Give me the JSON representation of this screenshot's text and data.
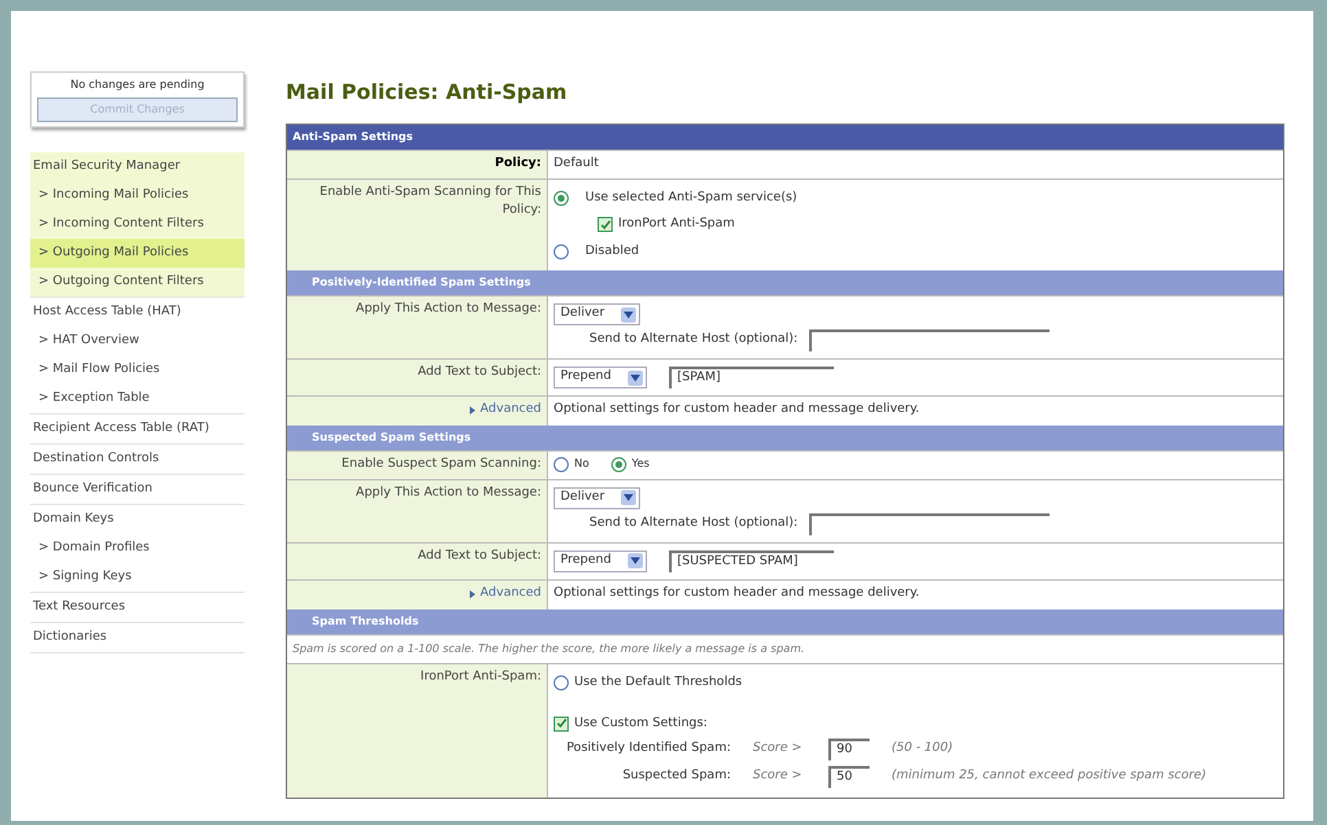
{
  "sidebar": {
    "pending_text": "No changes are pending",
    "commit_button": {
      "label": "Commit Changes",
      "disabled": true
    },
    "groups": [
      {
        "label": "Email Security Manager",
        "highlighted": true,
        "items": [
          {
            "label": "> Incoming Mail Policies",
            "selected": false
          },
          {
            "label": "> Incoming Content Filters",
            "selected": false
          },
          {
            "label": "> Outgoing Mail Policies",
            "selected": true
          },
          {
            "label": "> Outgoing Content Filters",
            "selected": false
          }
        ]
      },
      {
        "label": "Host Access Table (HAT)",
        "highlighted": false,
        "items": [
          {
            "label": "> HAT Overview",
            "selected": false
          },
          {
            "label": "> Mail Flow Policies",
            "selected": false
          },
          {
            "label": "> Exception Table",
            "selected": false
          }
        ]
      },
      {
        "label": "Recipient Access Table (RAT)",
        "highlighted": false
      },
      {
        "label": "Destination Controls",
        "highlighted": false
      },
      {
        "label": "Bounce Verification",
        "highlighted": false
      },
      {
        "label": "Domain Keys",
        "highlighted": false,
        "items": [
          {
            "label": "> Domain Profiles",
            "selected": false
          },
          {
            "label": "> Signing Keys",
            "selected": false
          }
        ]
      },
      {
        "label": "Text Resources",
        "highlighted": false
      },
      {
        "label": "Dictionaries",
        "highlighted": false
      }
    ]
  },
  "page_title": "Mail Policies: Anti-Spam",
  "sections": [
    {
      "title": "Anti-Spam Settings",
      "main": true,
      "rows": [
        {
          "kind": "policy",
          "label": "Policy:",
          "value": "Default"
        },
        {
          "kind": "enable",
          "label": "Enable Anti-Spam Scanning for This Policy:",
          "options": [
            {
              "label": "Use selected Anti-Spam service(s)",
              "selected": true,
              "sub": {
                "label": "IronPort Anti-Spam",
                "checked": true
              }
            },
            {
              "label": "Disabled",
              "selected": false
            }
          ]
        }
      ]
    },
    {
      "title": "Positively-Identified Spam Settings",
      "main": false,
      "rows": [
        {
          "kind": "action",
          "label": "Apply This Action to Message:",
          "select": "Deliver",
          "host_label": "Send to Alternate Host (optional):"
        },
        {
          "kind": "subject",
          "label": "Add Text to Subject:",
          "select": "Prepend",
          "value": "[SPAM]"
        },
        {
          "kind": "advanced",
          "label": "Advanced",
          "text": "Optional settings for custom header and message delivery."
        }
      ]
    },
    {
      "title": "Suspected Spam Settings",
      "main": false,
      "rows": [
        {
          "kind": "yesno",
          "label": "Enable Suspect Spam Scanning:",
          "options": [
            {
              "label": "No",
              "selected": false
            },
            {
              "label": "Yes",
              "selected": true
            }
          ]
        },
        {
          "kind": "action",
          "label": "Apply This Action to Message:",
          "select": "Deliver",
          "host_label": "Send to Alternate Host (optional):"
        },
        {
          "kind": "subject",
          "label": "Add Text to Subject:",
          "select": "Prepend",
          "value": "[SUSPECTED SPAM]"
        },
        {
          "kind": "advanced",
          "label": "Advanced",
          "text": "Optional settings for custom header and message delivery."
        }
      ]
    },
    {
      "title": "Spam Thresholds",
      "main": false,
      "rows": [
        {
          "kind": "note",
          "text": "Spam is scored on a 1-100 scale. The higher the score, the more likely a message is a spam."
        },
        {
          "kind": "thresholds",
          "label": "IronPort Anti-Spam:",
          "default_option": {
            "label": "Use the Default Thresholds",
            "selected": false
          },
          "custom_option": {
            "label": "Use Custom Settings:",
            "checked": true
          },
          "scores": [
            {
              "label": "Positively Identified Spam:",
              "prefix": "Score >",
              "value": "90",
              "hint": "(50 - 100)"
            },
            {
              "label": "Suspected Spam:",
              "prefix": "Score >",
              "value": "50",
              "hint": "(minimum 25, cannot exceed positive spam score)"
            }
          ]
        }
      ]
    }
  ]
}
